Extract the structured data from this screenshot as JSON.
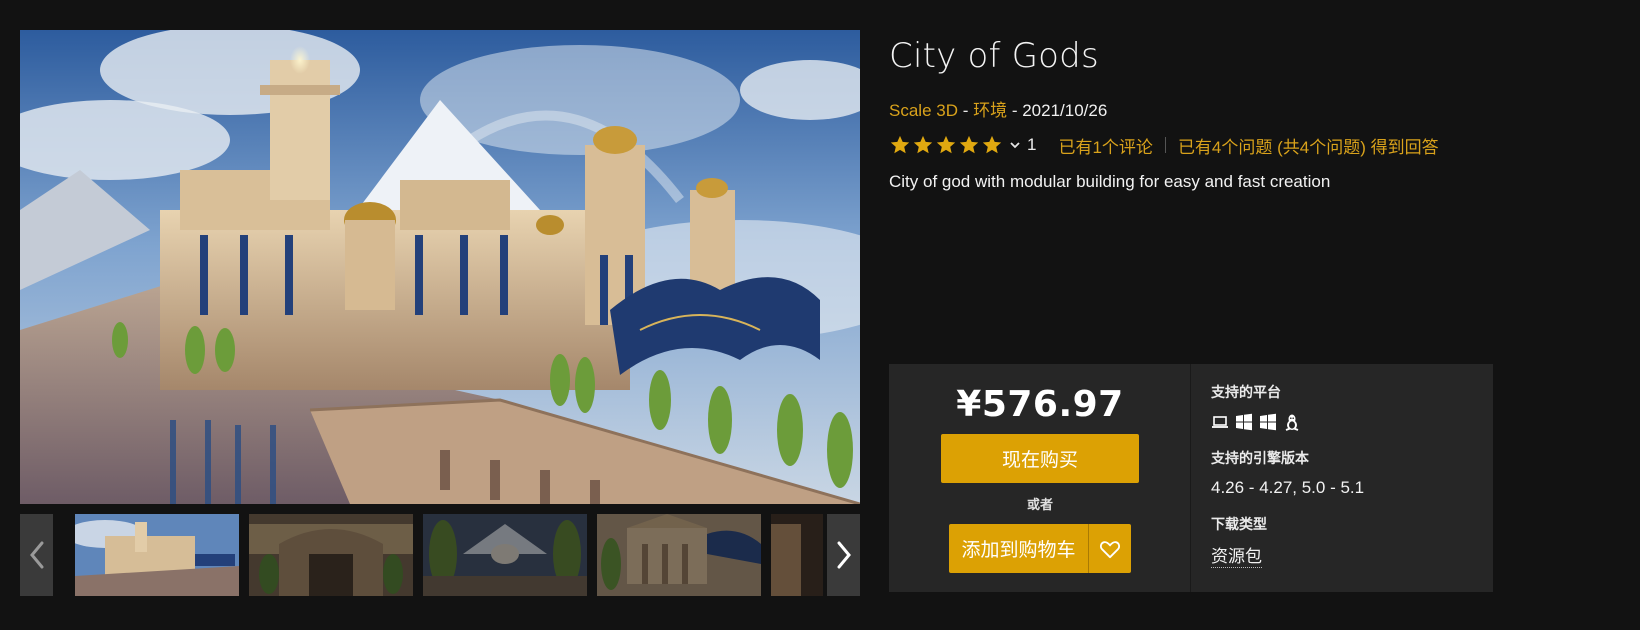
{
  "product": {
    "title": "City of Gods",
    "seller": "Scale 3D",
    "sep1": " - ",
    "category": "环境",
    "sep2": " - ",
    "date": "2021/10/26",
    "rating_value": 5,
    "rating_count": "1",
    "reviews_link": "已有1个评论",
    "questions_link": "已有4个问题 (共4个问题) 得到回答",
    "description": "City of god with modular building for easy and fast creation"
  },
  "purchase": {
    "price": "¥576.97",
    "buy_label": "现在购买",
    "or_label": "或者",
    "cart_label": "添加到购物车"
  },
  "details": {
    "platforms_label": "支持的平台",
    "platforms": [
      "laptop-icon",
      "windows-icon",
      "windows-icon",
      "linux-icon"
    ],
    "engine_label": "支持的引擎版本",
    "engine_value": "4.26 - 4.27, 5.0 - 5.1",
    "download_label": "下载类型",
    "download_value": "资源包"
  },
  "colors": {
    "accent": "#dca104",
    "link": "#d9a21b",
    "background": "#121212",
    "panel": "#262626"
  }
}
